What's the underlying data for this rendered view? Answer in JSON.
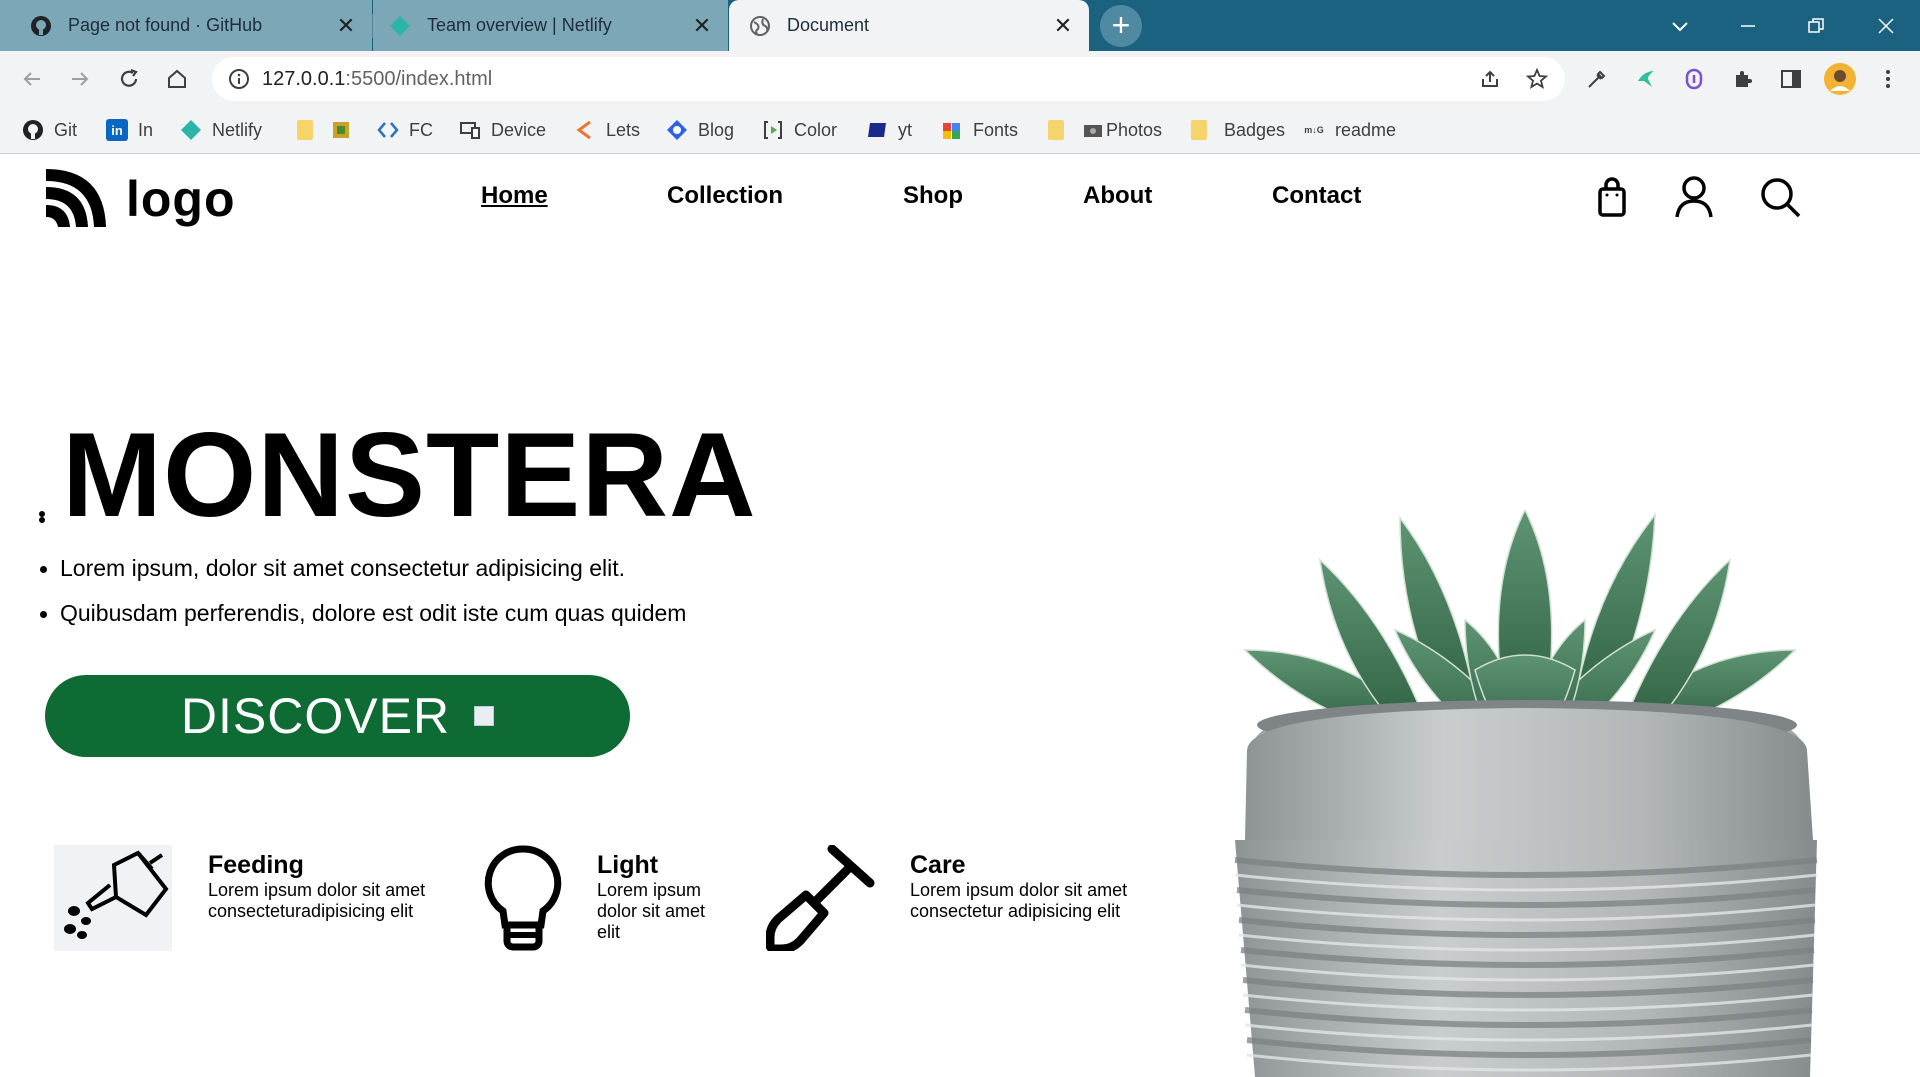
{
  "browser": {
    "tabs": [
      {
        "title": "Page not found · GitHub",
        "icon": "github-icon"
      },
      {
        "title": "Team overview | Netlify",
        "icon": "netlify-icon"
      },
      {
        "title": "Document",
        "icon": "globe-icon"
      }
    ],
    "close_glyph": "✕",
    "new_tab_glyph": "+",
    "url_host": "127.0.0.1",
    "url_path": ":5500/index.html",
    "bookmarks": [
      {
        "label": "Git",
        "icon": "github-icon"
      },
      {
        "label": "In",
        "icon": "linkedin-icon"
      },
      {
        "label": "Netlify",
        "icon": "netlify-icon"
      },
      {
        "label": "",
        "icon": "folder-icon"
      },
      {
        "label": "",
        "icon": "app-icon"
      },
      {
        "label": "FC",
        "icon": "code-icon"
      },
      {
        "label": "Device",
        "icon": "device-icon"
      },
      {
        "label": "Lets",
        "icon": "lets-icon"
      },
      {
        "label": "Blog",
        "icon": "blog-icon"
      },
      {
        "label": "Color",
        "icon": "color-icon"
      },
      {
        "label": "yt",
        "icon": "yt-icon"
      },
      {
        "label": "Fonts",
        "icon": "fonts-icon"
      },
      {
        "label": "",
        "icon": "folder-icon"
      },
      {
        "label": "Photos",
        "icon": "photos-icon"
      },
      {
        "label": "",
        "icon": "folder-icon"
      },
      {
        "label": "Badges",
        "icon": "badges-icon"
      },
      {
        "label": "readme",
        "icon": "readme-icon"
      }
    ],
    "colors": {
      "tabbar": "#1a6280",
      "toolbar": "#f1f3f4"
    }
  },
  "site": {
    "logo_text": "logo",
    "nav": [
      "Home",
      "Collection",
      "Shop",
      "About",
      "Contact"
    ],
    "hero_title": "MONSTERA",
    "hero_points": [
      "Lorem ipsum, dolor sit amet consectetur adipisicing elit.",
      "Quibusdam perferendis, dolore est odit iste cum quas quidem"
    ],
    "discover_label": "DISCOVER",
    "features": [
      {
        "title": "Feeding",
        "lines": [
          "Lorem ipsum dolor sit amet",
          "consecteturadipisicing elit"
        ],
        "icon": "watering-can-icon"
      },
      {
        "title": "Light",
        "lines": [
          "Lorem ipsum",
          "dolor sit amet",
          "elit"
        ],
        "icon": "lightbulb-icon"
      },
      {
        "title": "Care",
        "lines": [
          "Lorem ipsum dolor sit amet",
          "consectetur adipisicing elit"
        ],
        "icon": "shovel-icon"
      }
    ],
    "colors": {
      "discover_bg": "#0f6b34",
      "leaf": "#3f7a55",
      "pot": "#b6babb"
    }
  }
}
